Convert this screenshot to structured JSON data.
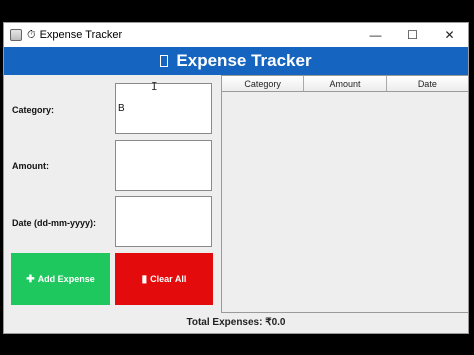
{
  "window": {
    "title": "Expense Tracker",
    "title_prefix_icon": "stopwatch-icon",
    "controls": {
      "minimize": "—",
      "maximize": "☐",
      "close": "✕"
    }
  },
  "banner": {
    "icon": "missing-glyph-icon",
    "title": "Expense Tracker"
  },
  "form": {
    "category_label": "Category:",
    "category_value": "B",
    "amount_label": "Amount:",
    "amount_value": "",
    "date_label": "Date (dd-mm-yyyy):",
    "date_value": ""
  },
  "buttons": {
    "add_icon": "✚",
    "add_label": "Add Expense",
    "clear_icon": "🗑",
    "clear_label": "Clear All"
  },
  "table": {
    "columns": [
      "Category",
      "Amount",
      "Date"
    ],
    "rows": []
  },
  "footer": {
    "total_text": "Total Expenses: ₹0.0"
  },
  "colors": {
    "banner": "#1565c0",
    "add_button": "#1fc85e",
    "clear_button": "#e30b0b",
    "window_bg": "#eeeeee"
  }
}
